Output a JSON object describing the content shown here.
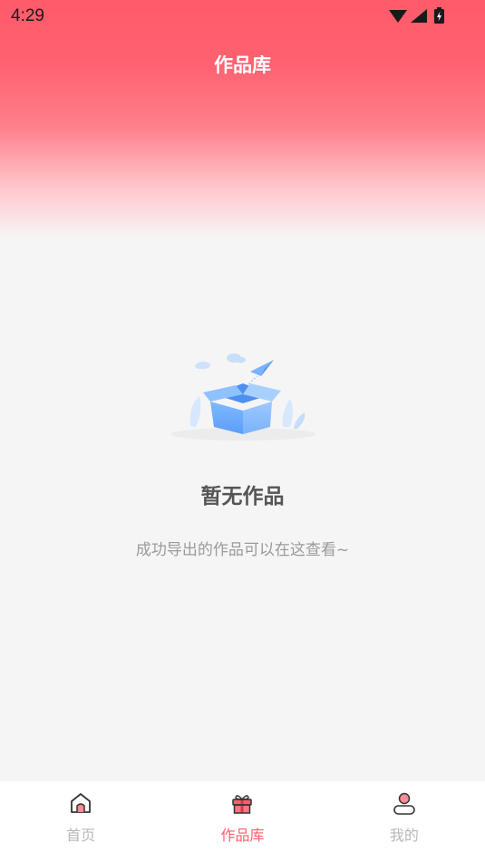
{
  "status_bar": {
    "time": "4:29",
    "icons": [
      "wifi-icon",
      "signal-icon",
      "battery-charging-icon"
    ]
  },
  "header": {
    "title": "作品库"
  },
  "empty_state": {
    "illustration": "open-box-paper-plane-icon",
    "title": "暂无作品",
    "subtitle": "成功导出的作品可以在这查看~"
  },
  "nav": {
    "items": [
      {
        "label": "首页",
        "icon": "home-icon",
        "active": false
      },
      {
        "label": "作品库",
        "icon": "gift-icon",
        "active": true
      },
      {
        "label": "我的",
        "icon": "user-icon",
        "active": false
      }
    ]
  },
  "colors": {
    "accent": "#ff5d6b",
    "header_top": "#ff5b6a",
    "background": "#f5f5f5",
    "inactive": "#b8b8b8"
  }
}
